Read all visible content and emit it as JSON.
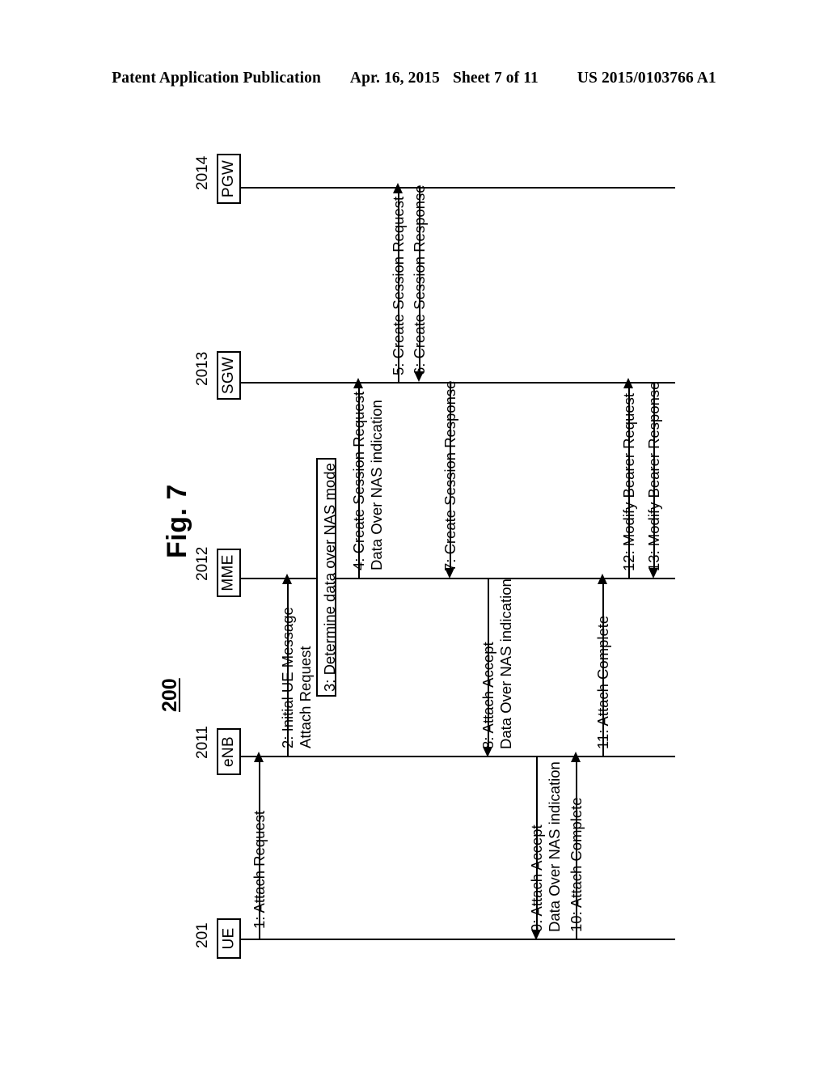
{
  "header": {
    "publication": "Patent Application Publication",
    "date": "Apr. 16, 2015",
    "sheet": "Sheet 7 of 11",
    "docnum": "US 2015/0103766 A1"
  },
  "figure": {
    "title": "Fig. 7",
    "number": "200",
    "type": "sequence-diagram"
  },
  "lifelines": [
    {
      "id": "pgw",
      "label": "PGW",
      "ref": "2014"
    },
    {
      "id": "sgw",
      "label": "SGW",
      "ref": "2013"
    },
    {
      "id": "mme",
      "label": "MME",
      "ref": "2012"
    },
    {
      "id": "enb",
      "label": "eNB",
      "ref": "2011"
    },
    {
      "id": "ue",
      "label": "UE",
      "ref": "201"
    }
  ],
  "messages": [
    {
      "num": "1",
      "line1": "1: Attach Request",
      "line2": "",
      "from": "ue",
      "to": "enb"
    },
    {
      "num": "2",
      "line1": "2: Initial UE Message",
      "line2": "Attach Request",
      "from": "enb",
      "to": "mme"
    },
    {
      "num": "4",
      "line1": "4: Create Session Request",
      "line2": "Data Over NAS indication",
      "from": "mme",
      "to": "sgw"
    },
    {
      "num": "5",
      "line1": "5: Create Session Request",
      "line2": "",
      "from": "sgw",
      "to": "pgw"
    },
    {
      "num": "6",
      "line1": "6: Create Session Response",
      "line2": "",
      "from": "pgw",
      "to": "sgw"
    },
    {
      "num": "7",
      "line1": "7: Create Session Response",
      "line2": "",
      "from": "sgw",
      "to": "mme"
    },
    {
      "num": "8",
      "line1": "8: Attach Accept",
      "line2": "Data Over NAS indication",
      "from": "mme",
      "to": "enb"
    },
    {
      "num": "9",
      "line1": "9: Attach Accept",
      "line2": "Data Over NAS indication",
      "from": "enb",
      "to": "ue"
    },
    {
      "num": "10",
      "line1": "10: Attach Complete",
      "line2": "",
      "from": "ue",
      "to": "enb"
    },
    {
      "num": "11",
      "line1": "11: Attach Complete",
      "line2": "",
      "from": "enb",
      "to": "mme"
    },
    {
      "num": "12",
      "line1": "12: Modify Bearer Request",
      "line2": "",
      "from": "mme",
      "to": "sgw"
    },
    {
      "num": "13",
      "line1": "13: Modify Bearer Response",
      "line2": "",
      "from": "sgw",
      "to": "mme"
    }
  ],
  "process_boxes": [
    {
      "num": "3",
      "label": "3: Determine data over NAS mode",
      "on": "mme"
    }
  ]
}
